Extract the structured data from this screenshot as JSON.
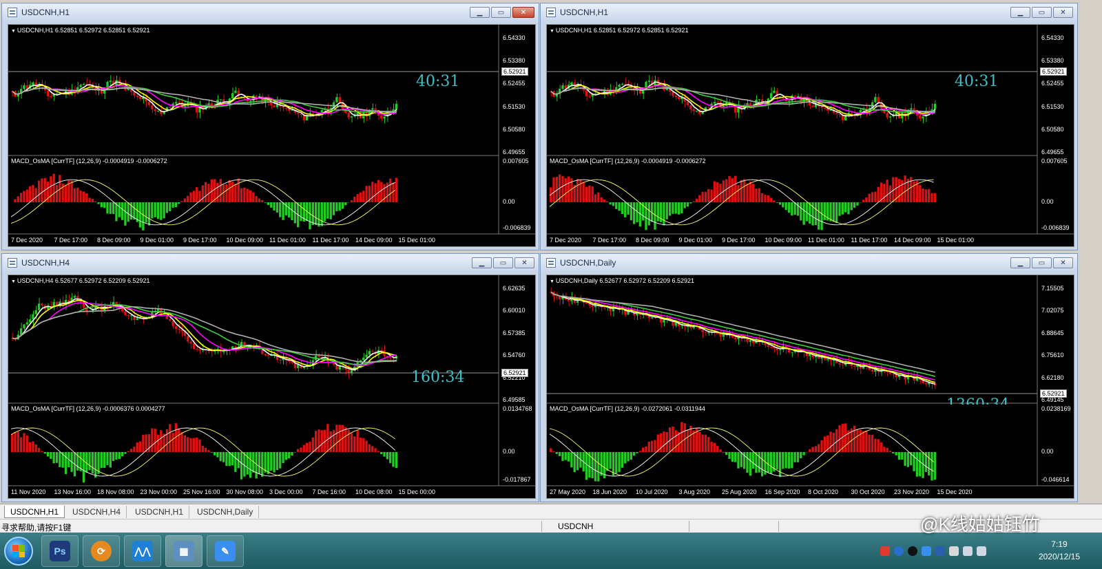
{
  "windows": [
    {
      "title": "USDCNH,H1",
      "active": true,
      "symbol_info": "USDCNH,H1  6.52851 6.52972 6.52851 6.52921",
      "timer": "40:31",
      "price_ticks": [
        "6.54330",
        "6.53380",
        "6.52455",
        "6.51530",
        "6.50580",
        "6.49655"
      ],
      "current_price": "6.52921",
      "macd_label": "MACD_OsMA [CurrTF] (12,26,9) -0.0004919 -0.0006272",
      "macd_ticks": [
        "0.007605",
        "0.00",
        "-0.006839"
      ],
      "x_labels": [
        "7 Dec 2020",
        "7 Dec 17:00",
        "8 Dec 09:00",
        "9 Dec 01:00",
        "9 Dec 17:00",
        "10 Dec 09:00",
        "11 Dec 01:00",
        "11 Dec 17:00",
        "14 Dec 09:00",
        "15 Dec 01:00"
      ]
    },
    {
      "title": "USDCNH,H1",
      "active": false,
      "symbol_info": "USDCNH,H1  6.52851 6.52972 6.52851 6.52921",
      "timer": "40:31",
      "price_ticks": [
        "6.54330",
        "6.53380",
        "6.52455",
        "6.51530",
        "6.50580",
        "6.49655"
      ],
      "current_price": "6.52921",
      "macd_label": "MACD_OsMA [CurrTF] (12,26,9) -0.0004919 -0.0006272",
      "macd_ticks": [
        "0.007605",
        "0.00",
        "-0.006839"
      ],
      "x_labels": [
        "7 Dec 2020",
        "7 Dec 17:00",
        "8 Dec 09:00",
        "9 Dec 01:00",
        "9 Dec 17:00",
        "10 Dec 09:00",
        "11 Dec 01:00",
        "11 Dec 17:00",
        "14 Dec 09:00",
        "15 Dec 01:00"
      ]
    },
    {
      "title": "USDCNH,H4",
      "active": false,
      "symbol_info": "USDCNH,H4  6.52677 6.52972 6.52209 6.52921",
      "timer": "160:34",
      "price_ticks": [
        "6.62635",
        "6.60010",
        "6.57385",
        "6.54760",
        "6.52210",
        "6.49585"
      ],
      "current_price": "6.52921",
      "macd_label": "MACD_OsMA [CurrTF] (12,26,9) -0.0006376 0.0004277",
      "macd_ticks": [
        "0.0134768",
        "0.00",
        "-0.017867"
      ],
      "x_labels": [
        "11 Nov 2020",
        "13 Nov 16:00",
        "18 Nov 08:00",
        "23 Nov 00:00",
        "25 Nov 16:00",
        "30 Nov 08:00",
        "3 Dec 00:00",
        "7 Dec 16:00",
        "10 Dec 08:00",
        "15 Dec 00:00"
      ]
    },
    {
      "title": "USDCNH,Daily",
      "active": false,
      "symbol_info": "USDCNH,Daily  6.52677 6.52972 6.52209 6.52921",
      "timer": "1360:34",
      "price_ticks": [
        "7.15505",
        "7.02075",
        "6.88645",
        "6.75610",
        "6.62180",
        "6.49145"
      ],
      "current_price": "6.52921",
      "macd_label": "MACD_OsMA [CurrTF] (12,26,9) -0.0272061 -0.0311944",
      "macd_ticks": [
        "0.0238169",
        "0.00",
        "-0.046614"
      ],
      "x_labels": [
        "27 May 2020",
        "18 Jun 2020",
        "10 Jul 2020",
        "3 Aug 2020",
        "25 Aug 2020",
        "16 Sep 2020",
        "8 Oct 2020",
        "30 Oct 2020",
        "23 Nov 2020",
        "15 Dec 2020"
      ]
    }
  ],
  "tabs": [
    "USDCNH,H1",
    "USDCNH,H4",
    "USDCNH,H1",
    "USDCNH,Daily"
  ],
  "status": {
    "hint": "寻求帮助,请按F1键",
    "symbol": "USDCNH"
  },
  "taskbar": {
    "apps": [
      {
        "icon": "photoshop-icon",
        "label": "Ps",
        "color": "#1e3a7a"
      },
      {
        "icon": "metatrader-icon",
        "label": "",
        "color": "#e58a1f"
      },
      {
        "icon": "cloud-app-icon",
        "label": "",
        "color": "#1f7fd6"
      },
      {
        "icon": "network-folder-icon",
        "label": "",
        "color": "#5d8fbf"
      },
      {
        "icon": "notes-icon",
        "label": "",
        "color": "#3a8ef0"
      }
    ],
    "time": "7:19",
    "date": "2020/12/15",
    "watermark": "@K线姑姑钰竹"
  },
  "colors": {
    "bull": "#22cc22",
    "bear": "#dd1111",
    "ma_fast": "#ffffff",
    "ma_mid": "#ffff00",
    "ma_slow1": "#ff00ff",
    "ma_slow2": "#3fcf3f",
    "ma_slow3": "#b0b0b0",
    "timer": "#3ec0c8"
  }
}
